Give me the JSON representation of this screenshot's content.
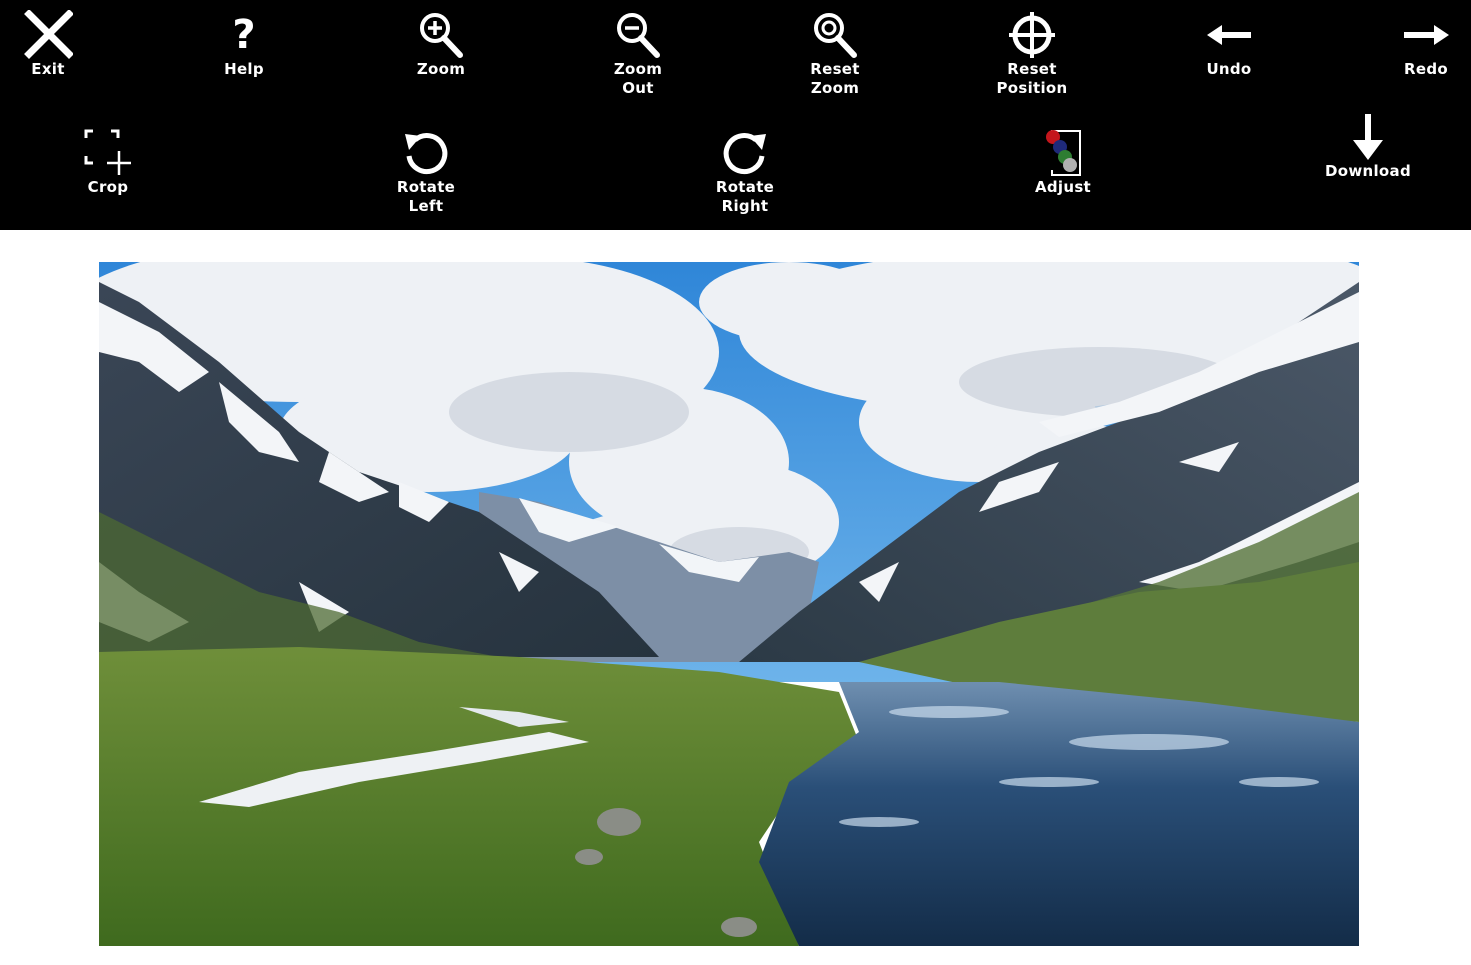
{
  "toolbar": {
    "exit": {
      "label": "Exit",
      "icon": "close-icon"
    },
    "help": {
      "label": "Help",
      "icon": "question-icon"
    },
    "zoom_in": {
      "label": "Zoom",
      "icon": "zoom-in-icon"
    },
    "zoom_out": {
      "label_line1": "Zoom",
      "label_line2": "Out",
      "icon": "zoom-out-icon"
    },
    "reset_zoom": {
      "label_line1": "Reset",
      "label_line2": "Zoom",
      "icon": "reset-zoom-icon"
    },
    "reset_position": {
      "label_line1": "Reset",
      "label_line2": "Position",
      "icon": "crosshair-icon"
    },
    "undo": {
      "label": "Undo",
      "icon": "arrow-left-icon"
    },
    "redo": {
      "label": "Redo",
      "icon": "arrow-right-icon"
    },
    "crop": {
      "label": "Crop",
      "icon": "crop-icon"
    },
    "rotate_left": {
      "label_line1": "Rotate",
      "label_line2": "Left",
      "icon": "rotate-left-icon"
    },
    "rotate_right": {
      "label_line1": "Rotate",
      "label_line2": "Right",
      "icon": "rotate-right-icon"
    },
    "adjust": {
      "label": "Adjust",
      "icon": "color-adjust-icon"
    },
    "download": {
      "label": "Download",
      "icon": "arrow-down-icon"
    }
  },
  "colors": {
    "toolbar_bg": "#000000",
    "icon": "#ffffff",
    "adjust_dots": [
      "#c4161c",
      "#1f2a7a",
      "#2e7d32",
      "#b0b0b0"
    ]
  },
  "image": {
    "subject": "mountain-valley-river-photo"
  }
}
